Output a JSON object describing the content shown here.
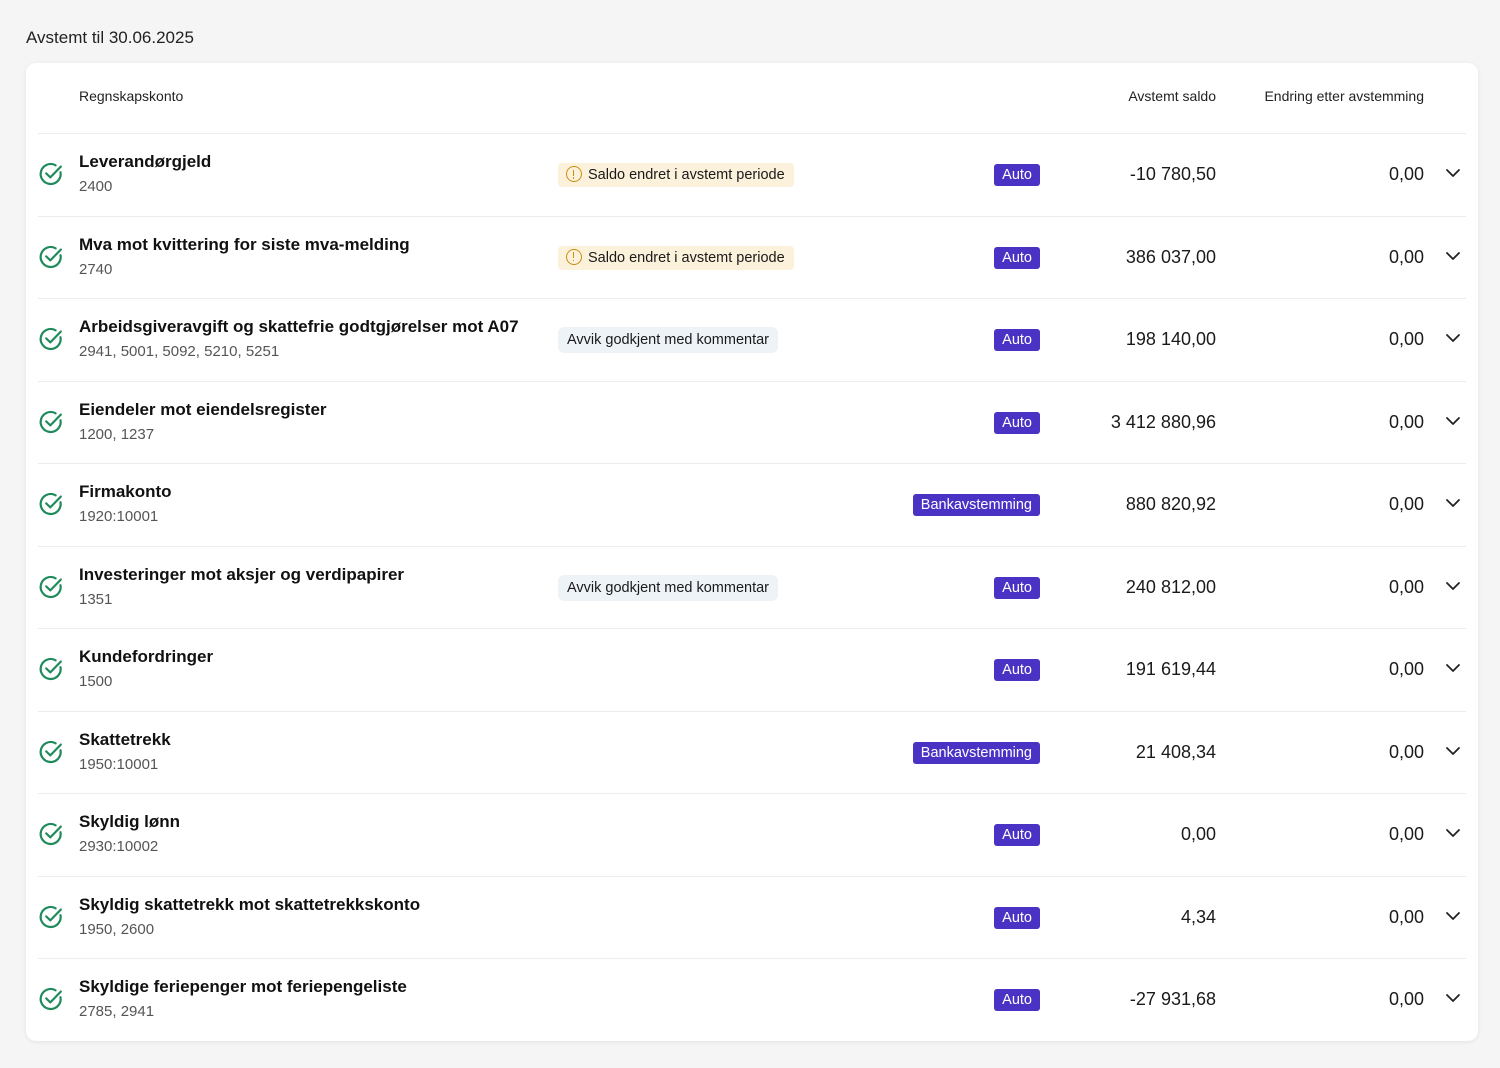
{
  "page": {
    "heading": "Avstemt til 30.06.2025"
  },
  "table": {
    "headers": {
      "account": "Regnskapskonto",
      "balance": "Avstemt saldo",
      "change": "Endring etter avstemming"
    },
    "colors": {
      "check": "#1f8a5b",
      "method_badge": "#4a33c4",
      "warning_bg": "#fcf1db",
      "warning_icon": "#c98f10",
      "info_bg": "#eef3f8"
    },
    "rows": [
      {
        "name": "Leverandørgjeld",
        "numbers": "2400",
        "status": "Saldo endret i avstemt periode",
        "status_type": "warning",
        "method": "Auto",
        "balance": "-10 780,50",
        "change": "0,00"
      },
      {
        "name": "Mva mot kvittering for siste mva-melding",
        "numbers": "2740",
        "status": "Saldo endret i avstemt periode",
        "status_type": "warning",
        "method": "Auto",
        "balance": "386 037,00",
        "change": "0,00"
      },
      {
        "name": "Arbeidsgiveravgift og skattefrie godtgjørelser mot A07",
        "numbers": "2941, 5001, 5092, 5210, 5251",
        "status": "Avvik godkjent med kommentar",
        "status_type": "info",
        "method": "Auto",
        "balance": "198 140,00",
        "change": "0,00"
      },
      {
        "name": "Eiendeler mot eiendelsregister",
        "numbers": "1200, 1237",
        "status": "",
        "status_type": "none",
        "method": "Auto",
        "balance": "3 412 880,96",
        "change": "0,00"
      },
      {
        "name": "Firmakonto",
        "numbers": "1920:10001",
        "status": "",
        "status_type": "none",
        "method": "Bankavstemming",
        "balance": "880 820,92",
        "change": "0,00"
      },
      {
        "name": "Investeringer mot aksjer og verdipapirer",
        "numbers": "1351",
        "status": "Avvik godkjent med kommentar",
        "status_type": "info",
        "method": "Auto",
        "balance": "240 812,00",
        "change": "0,00"
      },
      {
        "name": "Kundefordringer",
        "numbers": "1500",
        "status": "",
        "status_type": "none",
        "method": "Auto",
        "balance": "191 619,44",
        "change": "0,00"
      },
      {
        "name": "Skattetrekk",
        "numbers": "1950:10001",
        "status": "",
        "status_type": "none",
        "method": "Bankavstemming",
        "balance": "21 408,34",
        "change": "0,00"
      },
      {
        "name": "Skyldig lønn",
        "numbers": "2930:10002",
        "status": "",
        "status_type": "none",
        "method": "Auto",
        "balance": "0,00",
        "change": "0,00"
      },
      {
        "name": "Skyldig skattetrekk mot skattetrekkskonto",
        "numbers": "1950, 2600",
        "status": "",
        "status_type": "none",
        "method": "Auto",
        "balance": "4,34",
        "change": "0,00"
      },
      {
        "name": "Skyldige feriepenger mot feriepengeliste",
        "numbers": "2785, 2941",
        "status": "",
        "status_type": "none",
        "method": "Auto",
        "balance": "-27 931,68",
        "change": "0,00"
      }
    ]
  }
}
